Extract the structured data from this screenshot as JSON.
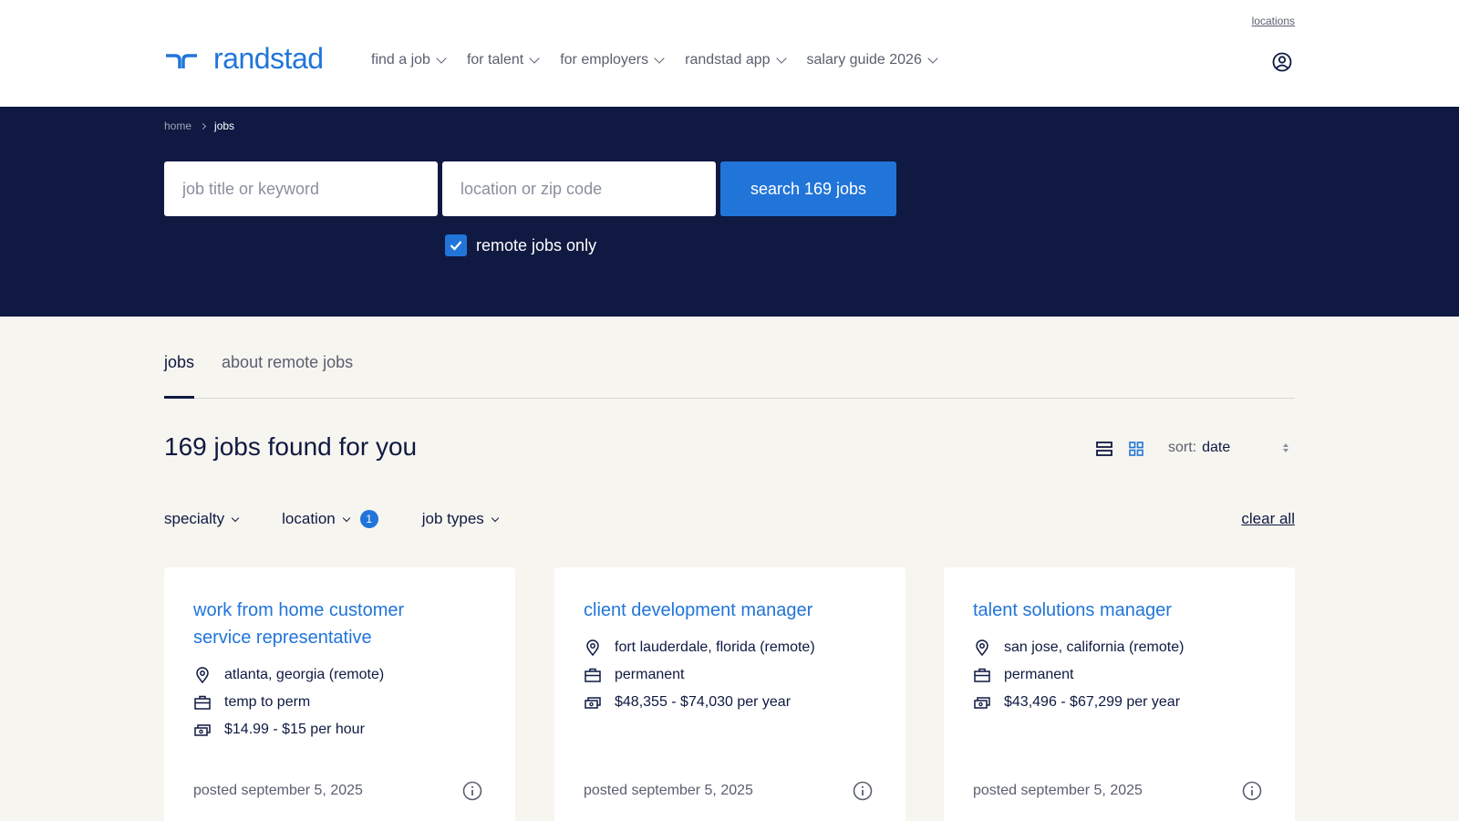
{
  "header": {
    "top_link": "locations",
    "logo_text": "randstad",
    "nav": [
      {
        "label": "find a job"
      },
      {
        "label": "for talent"
      },
      {
        "label": "for employers"
      },
      {
        "label": "randstad app"
      },
      {
        "label": "salary guide 2026"
      }
    ],
    "user_icon": "user-circle-icon"
  },
  "breadcrumb": {
    "home": "home",
    "current": "jobs"
  },
  "search": {
    "keyword_placeholder": "job title or keyword",
    "location_placeholder": "location or zip code",
    "button_label": "search 169 jobs",
    "remote_label": "remote jobs only",
    "remote_checked": true
  },
  "tabs": [
    {
      "label": "jobs",
      "active": true
    },
    {
      "label": "about remote jobs",
      "active": false
    }
  ],
  "results": {
    "title": "169 jobs found for you",
    "sort_label": "sort:",
    "sort_value": "date"
  },
  "filters": {
    "specialty": "specialty",
    "location": "location",
    "location_count": "1",
    "job_types": "job types",
    "clear_all": "clear all"
  },
  "jobs": [
    {
      "title": "work from home customer service representative",
      "location": "atlanta, georgia (remote)",
      "type": "temp to perm",
      "pay": "$14.99 - $15 per hour",
      "posted": "posted september 5, 2025"
    },
    {
      "title": "client development manager",
      "location": "fort lauderdale, florida (remote)",
      "type": "permanent",
      "pay": "$48,355 - $74,030 per year",
      "posted": "posted september 5, 2025"
    },
    {
      "title": "talent solutions manager",
      "location": "san jose, california (remote)",
      "type": "permanent",
      "pay": "$43,496 - $67,299 per year",
      "posted": "posted september 5, 2025"
    }
  ],
  "colors": {
    "navy": "#0f1941",
    "blue": "#2175d9",
    "background": "#f7f5f0"
  }
}
